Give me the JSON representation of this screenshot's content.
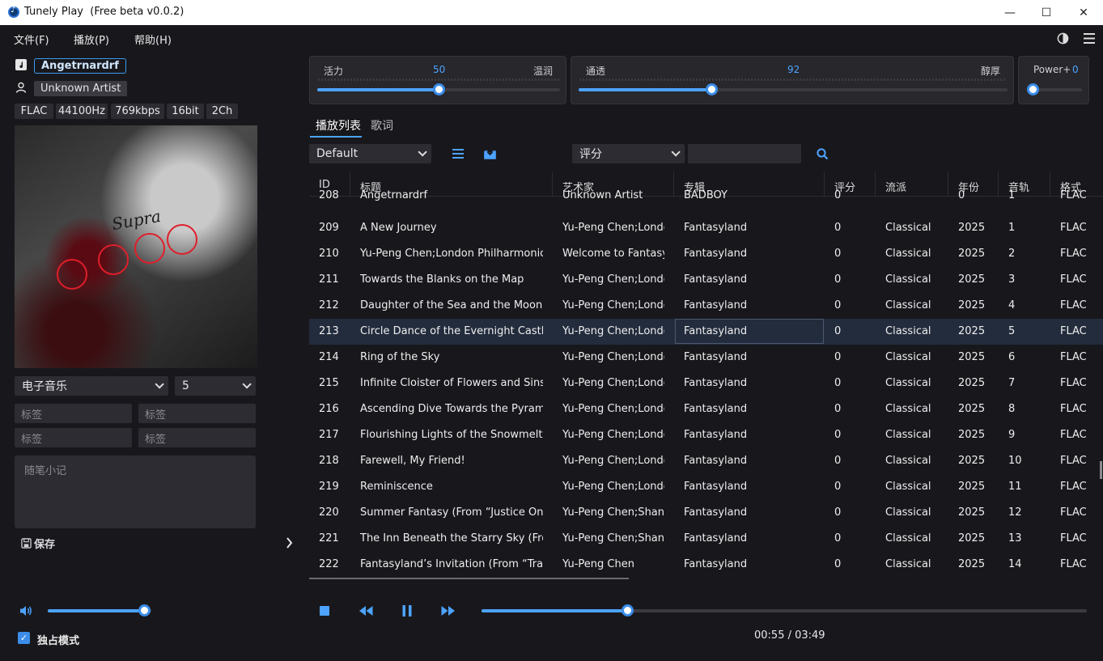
{
  "window": {
    "title": "Tunely Play  (Free beta v0.0.2)",
    "minimize": "—",
    "maximize": "☐",
    "close": "✕"
  },
  "menu": {
    "items": [
      "文件(F)",
      "播放(P)",
      "帮助(H)"
    ]
  },
  "track": {
    "title": "Angetrnardrf",
    "artist": "Unknown Artist",
    "specs": [
      "FLAC",
      "44100Hz",
      "769kbps",
      "16bit",
      "2Ch"
    ],
    "genre": "电子音乐",
    "rating": "5",
    "tag_placeholder": "标签",
    "notes_placeholder": "随笔小记",
    "save_label": "保存",
    "cover_text": "Supra"
  },
  "eq": {
    "warm": {
      "left": "活力",
      "right": "温润",
      "value": "50",
      "fraction": 0.5
    },
    "clear": {
      "left": "通透",
      "right": "醇厚",
      "value": "92",
      "fraction": 0.31
    },
    "power": {
      "label": "Power+",
      "value": "0",
      "fraction": 0.0
    }
  },
  "tabs": [
    "播放列表",
    "歌词"
  ],
  "playlist": {
    "selected": "Default"
  },
  "sort": {
    "selected": "评分"
  },
  "columns": [
    "ID",
    "标题",
    "艺术家",
    "专辑",
    "评分",
    "流派",
    "年份",
    "音轨",
    "格式"
  ],
  "rows": [
    [
      "208",
      "Angetrnardrf",
      "Unknown Artist",
      "BADBOY",
      "0",
      "",
      "0",
      "1",
      "FLAC"
    ],
    [
      "209",
      "A New Journey",
      "Yu-Peng Chen;London",
      "Fantasyland",
      "0",
      "Classical",
      "2025",
      "1",
      "FLAC"
    ],
    [
      "210",
      "Yu-Peng Chen;London Philharmonic",
      "Welcome to Fantasy",
      "Fantasyland",
      "0",
      "Classical",
      "2025",
      "2",
      "FLAC"
    ],
    [
      "211",
      "Towards the Blanks on the Map",
      "Yu-Peng Chen;London",
      "Fantasyland",
      "0",
      "Classical",
      "2025",
      "3",
      "FLAC"
    ],
    [
      "212",
      "Daughter of the Sea and the Moon",
      "Yu-Peng Chen;London",
      "Fantasyland",
      "0",
      "Classical",
      "2025",
      "4",
      "FLAC"
    ],
    [
      "213",
      "Circle Dance of the Evernight Castle",
      "Yu-Peng Chen;London",
      "Fantasyland",
      "0",
      "Classical",
      "2025",
      "5",
      "FLAC"
    ],
    [
      "214",
      "Ring of the Sky",
      "Yu-Peng Chen;London",
      "Fantasyland",
      "0",
      "Classical",
      "2025",
      "6",
      "FLAC"
    ],
    [
      "215",
      "Infinite Cloister of Flowers and Sins",
      "Yu-Peng Chen;London",
      "Fantasyland",
      "0",
      "Classical",
      "2025",
      "7",
      "FLAC"
    ],
    [
      "216",
      "Ascending Dive Towards the Pyramid",
      "Yu-Peng Chen;London",
      "Fantasyland",
      "0",
      "Classical",
      "2025",
      "8",
      "FLAC"
    ],
    [
      "217",
      "Flourishing Lights of the Snowmelt R",
      "Yu-Peng Chen;London",
      "Fantasyland",
      "0",
      "Classical",
      "2025",
      "9",
      "FLAC"
    ],
    [
      "218",
      "Farewell, My Friend!",
      "Yu-Peng Chen;London",
      "Fantasyland",
      "0",
      "Classical",
      "2025",
      "10",
      "FLAC"
    ],
    [
      "219",
      "Reminiscence",
      "Yu-Peng Chen;London",
      "Fantasyland",
      "0",
      "Classical",
      "2025",
      "11",
      "FLAC"
    ],
    [
      "220",
      "Summer Fantasy (From  “Justice Onl",
      "Yu-Peng Chen;Shang",
      "Fantasyland",
      "0",
      "Classical",
      "2025",
      "12",
      "FLAC"
    ],
    [
      "221",
      "The Inn Beneath the Starry Sky (From",
      "Yu-Peng Chen;Shang",
      "Fantasyland",
      "0",
      "Classical",
      "2025",
      "13",
      "FLAC"
    ],
    [
      "222",
      "Fantasyland’s Invitation (From  “Tra",
      "Yu-Peng Chen",
      "Fantasyland",
      "0",
      "Classical",
      "2025",
      "14",
      "FLAC"
    ]
  ],
  "selected_row": 5,
  "player": {
    "volume_fraction": 0.93,
    "progress_fraction": 0.24,
    "elapsed": "00:55",
    "total": "03:49",
    "time_text": "00:55 / 03:49"
  },
  "exclusive_mode": {
    "label": "独占模式",
    "checked": true
  },
  "colors": {
    "accent": "#4da3ff",
    "background": "#18181c",
    "selected_row": "#232c3c"
  }
}
